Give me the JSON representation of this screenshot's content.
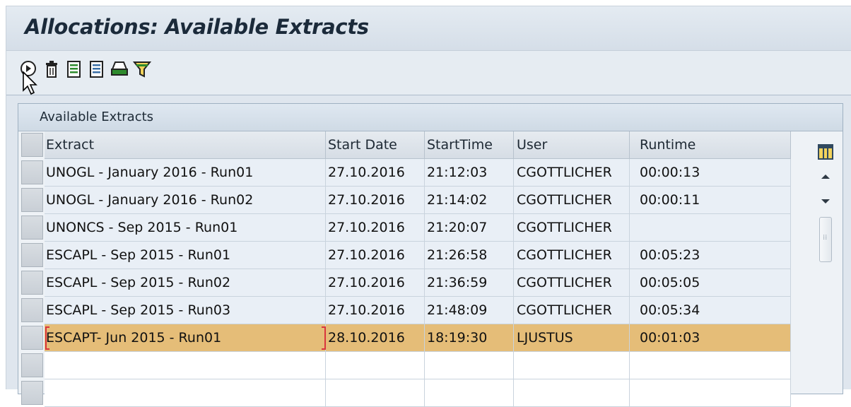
{
  "window": {
    "title": "Allocations: Available Extracts"
  },
  "toolbar": {
    "buttons": [
      {
        "name": "execute-button",
        "icon": "execute-icon"
      },
      {
        "name": "delete-button",
        "icon": "trash-icon"
      },
      {
        "name": "details-button",
        "icon": "document-icon"
      },
      {
        "name": "details2-button",
        "icon": "document-icon"
      },
      {
        "name": "print-button",
        "icon": "printer-icon"
      },
      {
        "name": "filter-button",
        "icon": "filter-icon"
      }
    ]
  },
  "panel": {
    "title": "Available Extracts"
  },
  "table": {
    "columns": [
      "Extract",
      "Start Date",
      "StartTime",
      "User",
      "Runtime"
    ],
    "rows": [
      [
        "UNOGL - January 2016 - Run01",
        "27.10.2016",
        "21:12:03",
        "CGOTTLICHER",
        "00:00:13"
      ],
      [
        "UNOGL - January 2016 - Run02",
        "27.10.2016",
        "21:14:02",
        "CGOTTLICHER",
        "00:00:11"
      ],
      [
        "UNONCS - Sep 2015 - Run01",
        "27.10.2016",
        "21:20:07",
        "CGOTTLICHER",
        ""
      ],
      [
        "ESCAPL - Sep 2015 - Run01",
        "27.10.2016",
        "21:26:58",
        "CGOTTLICHER",
        "00:05:23"
      ],
      [
        "ESCAPL - Sep 2015 - Run02",
        "27.10.2016",
        "21:36:59",
        "CGOTTLICHER",
        "00:05:05"
      ],
      [
        "ESCAPL - Sep 2015 - Run03",
        "27.10.2016",
        "21:48:09",
        "CGOTTLICHER",
        "00:05:34"
      ],
      [
        "ESCAPT- Jun 2015 - Run01",
        "28.10.2016",
        "18:19:30",
        "LJUSTUS",
        "00:01:03"
      ]
    ],
    "highlight_color": "#e5bd78"
  }
}
